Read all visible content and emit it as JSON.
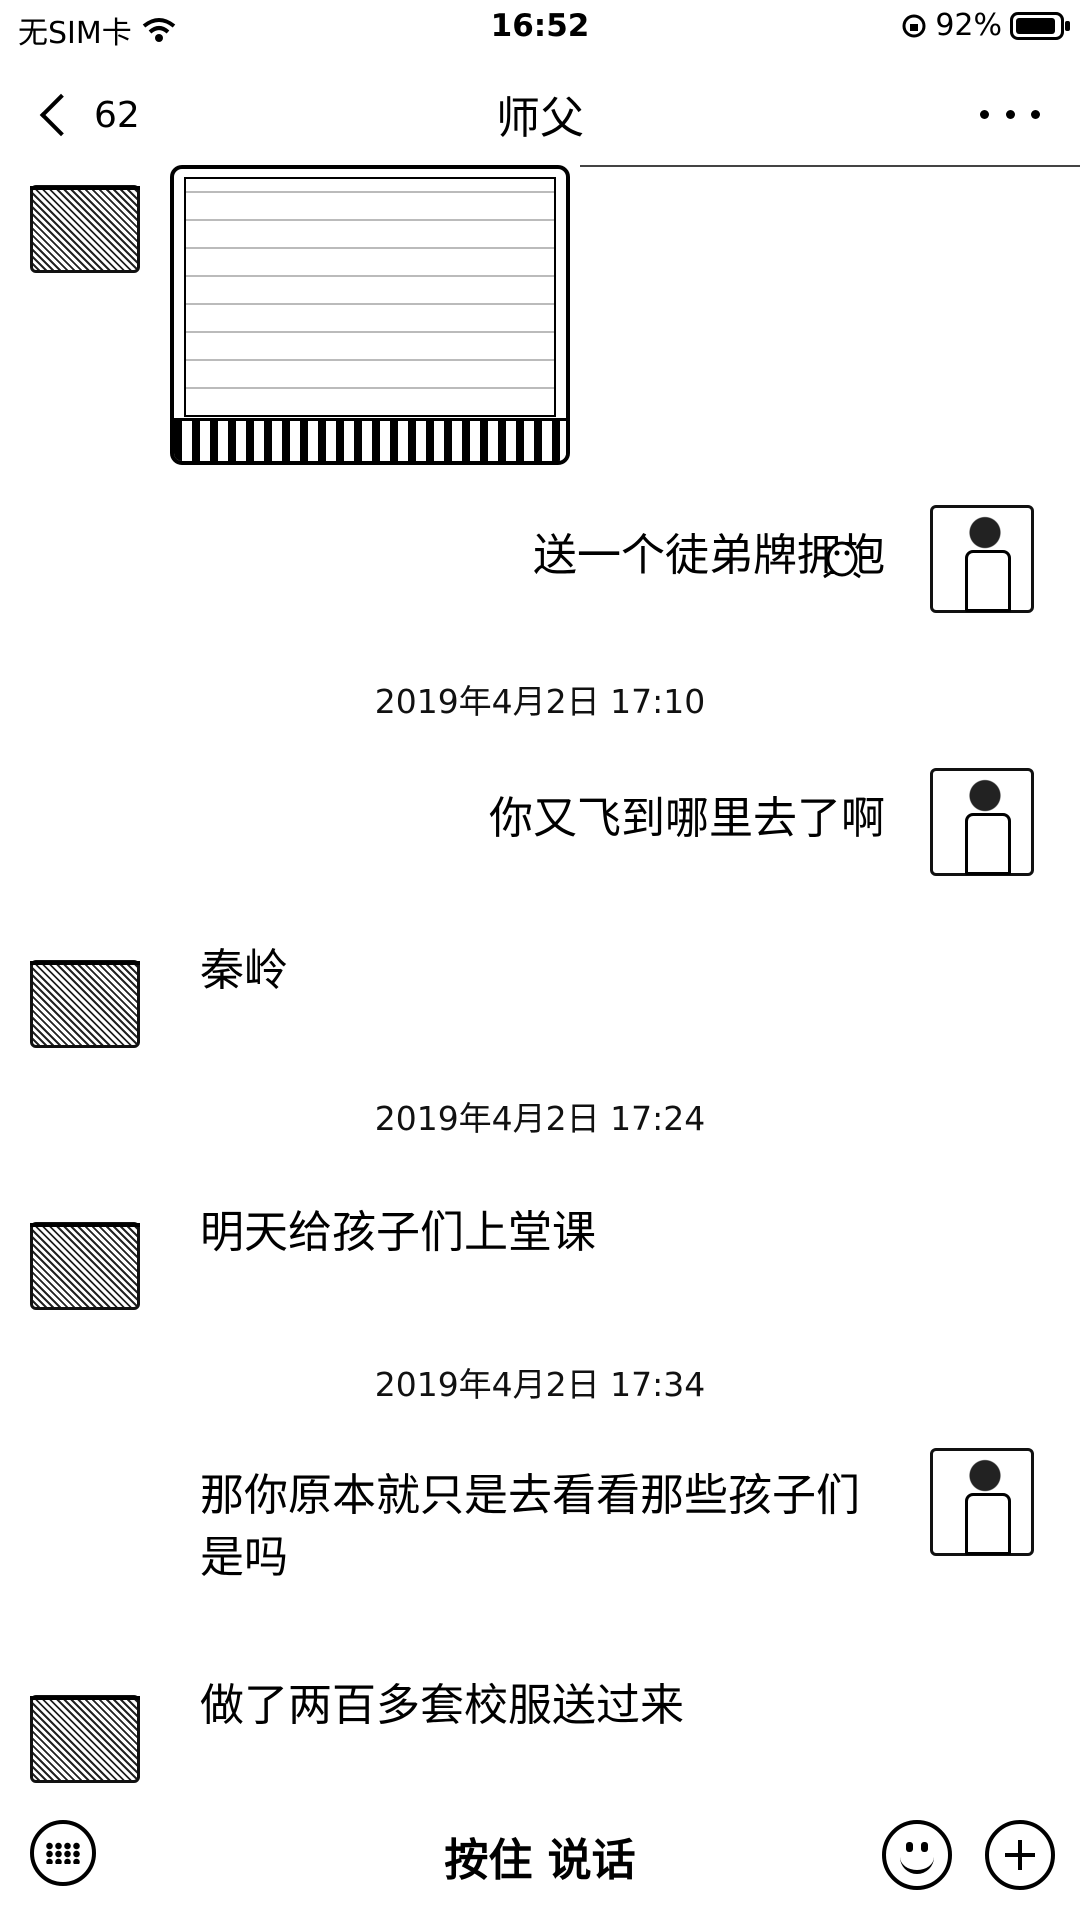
{
  "status_bar": {
    "carrier": "无SIM卡",
    "time": "16:52",
    "battery_percent": "92%",
    "battery_level": 0.92
  },
  "nav": {
    "back_count": "62",
    "title": "师父"
  },
  "messages": [
    {
      "type": "image",
      "side": "left"
    },
    {
      "type": "text",
      "side": "right",
      "text": "送一个徒弟牌拥抱"
    },
    {
      "type": "timestamp",
      "text": "2019年4月2日 17:10"
    },
    {
      "type": "text",
      "side": "right",
      "text": "你又飞到哪里去了啊"
    },
    {
      "type": "text",
      "side": "left",
      "text": "秦岭"
    },
    {
      "type": "timestamp",
      "text": "2019年4月2日 17:24"
    },
    {
      "type": "text",
      "side": "left",
      "text": "明天给孩子们上堂课"
    },
    {
      "type": "timestamp",
      "text": "2019年4月2日 17:34"
    },
    {
      "type": "text",
      "side": "right",
      "text": "那你原本就只是去看看那些孩子们\n是吗"
    },
    {
      "type": "text",
      "side": "left",
      "text": "做了两百多套校服送过来"
    }
  ],
  "input_bar": {
    "hold_to_talk": "按住 说话"
  },
  "icons": {
    "back": "chevron-left-icon",
    "more": "more-dots-icon",
    "keyboard": "keyboard-icon",
    "emoji": "emoji-icon",
    "plus": "plus-icon"
  }
}
